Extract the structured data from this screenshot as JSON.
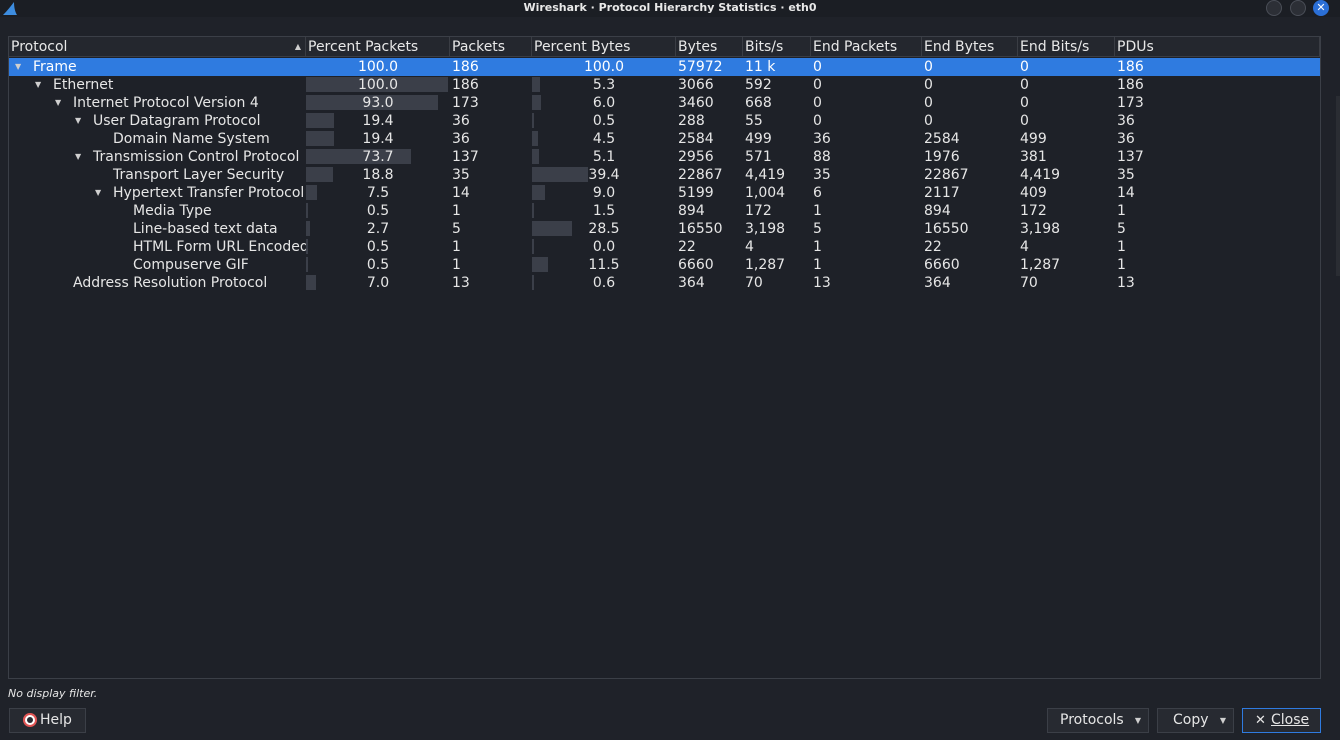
{
  "window": {
    "title": "Wireshark · Protocol Hierarchy Statistics · eth0"
  },
  "columns": [
    "Protocol",
    "Percent Packets",
    "Packets",
    "Percent Bytes",
    "Bytes",
    "Bits/s",
    "End Packets",
    "End Bytes",
    "End Bits/s",
    "PDUs"
  ],
  "rows": [
    {
      "depth": 0,
      "expander": true,
      "selected": true,
      "protocol": "Frame",
      "pct_packets": "100.0",
      "packets": "186",
      "pct_bytes": "100.0",
      "bytes": "57972",
      "bits": "11 k",
      "end_packets": "0",
      "end_bytes": "0",
      "end_bits": "0",
      "pdus": "186"
    },
    {
      "depth": 1,
      "expander": true,
      "selected": false,
      "protocol": "Ethernet",
      "pct_packets": "100.0",
      "packets": "186",
      "pct_bytes": "5.3",
      "bytes": "3066",
      "bits": "592",
      "end_packets": "0",
      "end_bytes": "0",
      "end_bits": "0",
      "pdus": "186"
    },
    {
      "depth": 2,
      "expander": true,
      "selected": false,
      "protocol": "Internet Protocol Version 4",
      "pct_packets": "93.0",
      "packets": "173",
      "pct_bytes": "6.0",
      "bytes": "3460",
      "bits": "668",
      "end_packets": "0",
      "end_bytes": "0",
      "end_bits": "0",
      "pdus": "173"
    },
    {
      "depth": 3,
      "expander": true,
      "selected": false,
      "protocol": "User Datagram Protocol",
      "pct_packets": "19.4",
      "packets": "36",
      "pct_bytes": "0.5",
      "bytes": "288",
      "bits": "55",
      "end_packets": "0",
      "end_bytes": "0",
      "end_bits": "0",
      "pdus": "36"
    },
    {
      "depth": 4,
      "expander": false,
      "selected": false,
      "protocol": "Domain Name System",
      "pct_packets": "19.4",
      "packets": "36",
      "pct_bytes": "4.5",
      "bytes": "2584",
      "bits": "499",
      "end_packets": "36",
      "end_bytes": "2584",
      "end_bits": "499",
      "pdus": "36"
    },
    {
      "depth": 3,
      "expander": true,
      "selected": false,
      "protocol": "Transmission Control Protocol",
      "pct_packets": "73.7",
      "packets": "137",
      "pct_bytes": "5.1",
      "bytes": "2956",
      "bits": "571",
      "end_packets": "88",
      "end_bytes": "1976",
      "end_bits": "381",
      "pdus": "137"
    },
    {
      "depth": 4,
      "expander": false,
      "selected": false,
      "protocol": "Transport Layer Security",
      "pct_packets": "18.8",
      "packets": "35",
      "pct_bytes": "39.4",
      "bytes": "22867",
      "bits": "4,419",
      "end_packets": "35",
      "end_bytes": "22867",
      "end_bits": "4,419",
      "pdus": "35"
    },
    {
      "depth": 4,
      "expander": true,
      "selected": false,
      "protocol": "Hypertext Transfer Protocol",
      "pct_packets": "7.5",
      "packets": "14",
      "pct_bytes": "9.0",
      "bytes": "5199",
      "bits": "1,004",
      "end_packets": "6",
      "end_bytes": "2117",
      "end_bits": "409",
      "pdus": "14"
    },
    {
      "depth": 5,
      "expander": false,
      "selected": false,
      "protocol": "Media Type",
      "pct_packets": "0.5",
      "packets": "1",
      "pct_bytes": "1.5",
      "bytes": "894",
      "bits": "172",
      "end_packets": "1",
      "end_bytes": "894",
      "end_bits": "172",
      "pdus": "1"
    },
    {
      "depth": 5,
      "expander": false,
      "selected": false,
      "protocol": "Line-based text data",
      "pct_packets": "2.7",
      "packets": "5",
      "pct_bytes": "28.5",
      "bytes": "16550",
      "bits": "3,198",
      "end_packets": "5",
      "end_bytes": "16550",
      "end_bits": "3,198",
      "pdus": "5"
    },
    {
      "depth": 5,
      "expander": false,
      "selected": false,
      "protocol": "HTML Form URL Encoded",
      "pct_packets": "0.5",
      "packets": "1",
      "pct_bytes": "0.0",
      "bytes": "22",
      "bits": "4",
      "end_packets": "1",
      "end_bytes": "22",
      "end_bits": "4",
      "pdus": "1"
    },
    {
      "depth": 5,
      "expander": false,
      "selected": false,
      "protocol": "Compuserve GIF",
      "pct_packets": "0.5",
      "packets": "1",
      "pct_bytes": "11.5",
      "bytes": "6660",
      "bits": "1,287",
      "end_packets": "1",
      "end_bytes": "6660",
      "end_bits": "1,287",
      "pdus": "1"
    },
    {
      "depth": 2,
      "expander": false,
      "selected": false,
      "protocol": "Address Resolution Protocol",
      "pct_packets": "7.0",
      "packets": "13",
      "pct_bytes": "0.6",
      "bytes": "364",
      "bits": "70",
      "end_packets": "13",
      "end_bytes": "364",
      "end_bits": "70",
      "pdus": "13"
    }
  ],
  "status": "No display filter.",
  "buttons": {
    "help": "Help",
    "protocols": "Protocols",
    "copy": "Copy",
    "close": "Close"
  },
  "icons": {
    "app": "wireshark-fin-icon",
    "help": "lifebuoy-icon",
    "close": "close-x-icon"
  },
  "colors": {
    "selection": "#2f7be0",
    "bar": "#3b3f49",
    "close_button": "#2b6fd6"
  }
}
